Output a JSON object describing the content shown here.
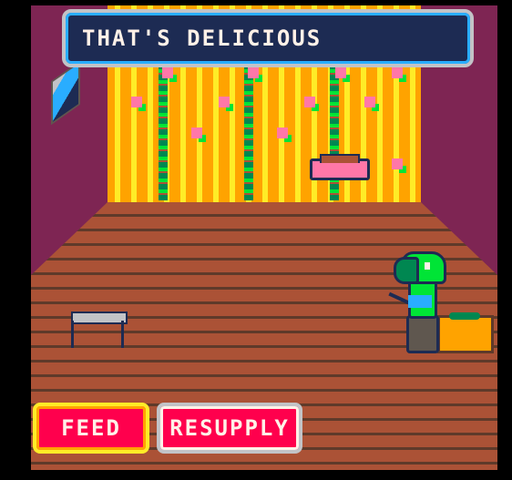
{
  "dialog": {
    "text": "THAT'S DELICIOUS"
  },
  "buttons": {
    "feed": "FEED",
    "resupply": "RESUPPLY"
  },
  "palette": {
    "wall": "#7e2553",
    "wallpaper": "#ffa300",
    "floor": "#ab5236",
    "dialog_bg": "#1d2b53",
    "button": "#ff004d"
  }
}
